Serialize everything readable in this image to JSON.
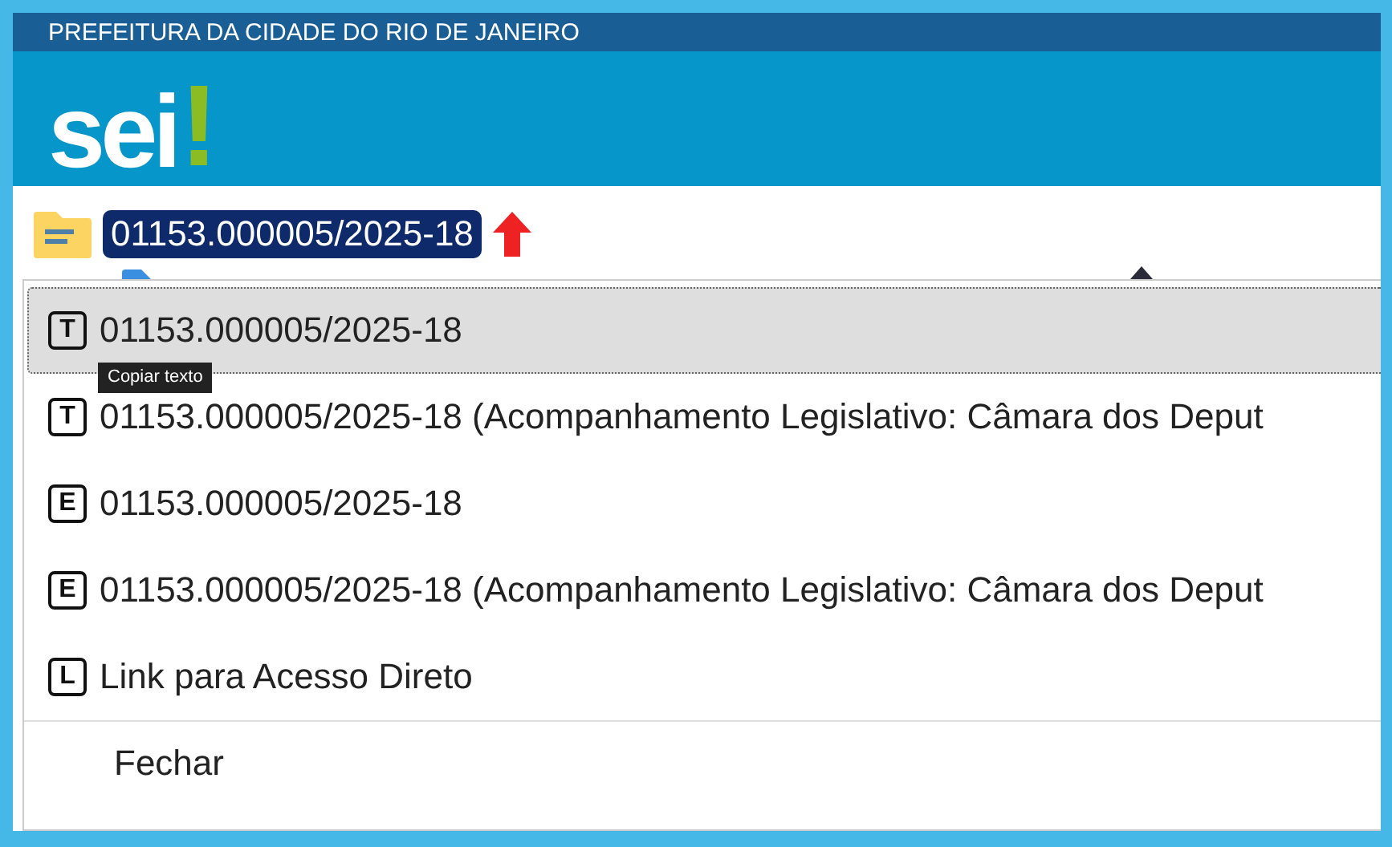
{
  "banner": {
    "title": "PREFEITURA DA CIDADE DO RIO DE JANEIRO"
  },
  "logo": {
    "text": "sei",
    "mark": "!"
  },
  "process": {
    "number": "01153.000005/2025-18"
  },
  "menu": {
    "items": [
      {
        "badge": "T",
        "label": "01153.000005/2025-18",
        "selected": true
      },
      {
        "badge": "T",
        "label": "01153.000005/2025-18 (Acompanhamento Legislativo: Câmara dos Deput",
        "selected": false
      },
      {
        "badge": "E",
        "label": "01153.000005/2025-18",
        "selected": false
      },
      {
        "badge": "E",
        "label": "01153.000005/2025-18 (Acompanhamento Legislativo: Câmara dos Deput",
        "selected": false
      },
      {
        "badge": "L",
        "label": "Link para Acesso Direto",
        "selected": false
      }
    ],
    "close": {
      "label": "Fechar"
    },
    "tooltip": "Copiar texto"
  }
}
